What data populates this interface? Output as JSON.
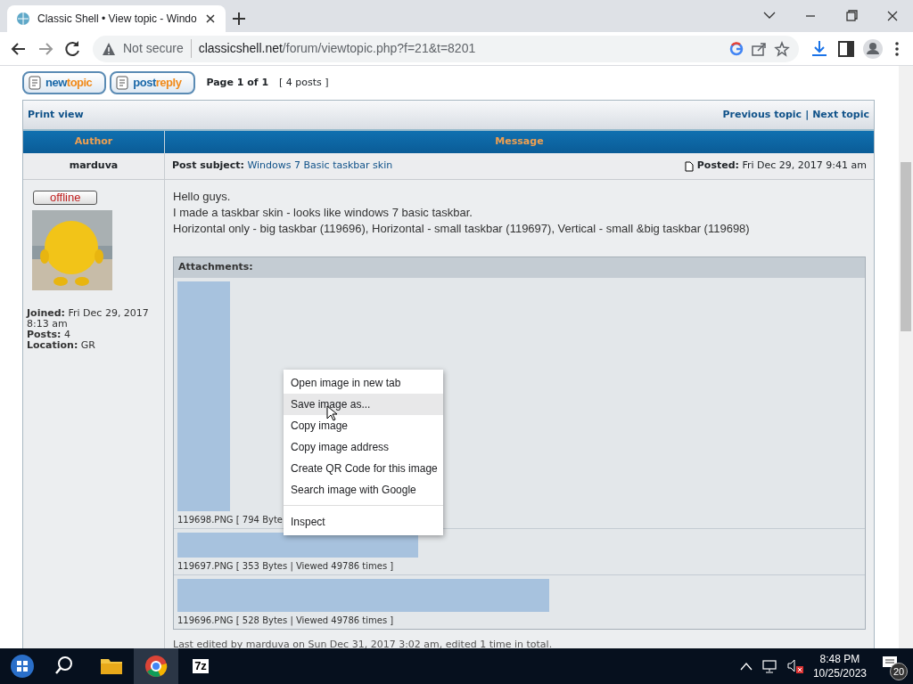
{
  "browser": {
    "tab_title": "Classic Shell • View topic - Windo",
    "security": "Not secure",
    "url_host": "classicshell.net",
    "url_path": "/forum/viewtopic.php?f=21&t=8201"
  },
  "toolbar": {
    "buttons": [
      {
        "first": "new",
        "second": "topic"
      },
      {
        "first": "post",
        "second": "reply"
      }
    ],
    "page_info": "Page 1 of 1",
    "posts_count": "[ 4 posts ]"
  },
  "nav": {
    "print_view": "Print view",
    "previous_topic": "Previous topic",
    "separator": "|",
    "next_topic": "Next topic"
  },
  "columns": [
    "Author",
    "Message"
  ],
  "post": {
    "author": "marduva",
    "status": "offline",
    "subject_label": "Post subject:",
    "subject": "Windows 7 Basic taskbar skin",
    "posted_label": "Posted:",
    "posted": "Fri Dec 29, 2017 9:41 am",
    "profile": [
      {
        "label": "Joined:",
        "value": "Fri Dec 29, 2017 8:13 am"
      },
      {
        "label": "Posts:",
        "value": "4"
      },
      {
        "label": "Location:",
        "value": "GR"
      }
    ],
    "body": [
      "Hello guys.",
      "I made a taskbar skin - looks like windows 7 basic taskbar.",
      "Horizontal only - big taskbar (119696), Horizontal - small taskbar (119697), Vertical - small &big taskbar (119698)"
    ],
    "attachments_title": "Attachments:",
    "attachments": [
      {
        "kind": "vertical",
        "info": "119698.PNG [ 794 Byte"
      },
      {
        "kind": "small",
        "info": "119697.PNG [ 353 Bytes | Viewed 49786 times ]"
      },
      {
        "kind": "big",
        "info": "119696.PNG [ 528 Bytes | Viewed 49786 times ]"
      }
    ],
    "edited": "Last edited by marduva on Sun Dec 31, 2017 3:02 am, edited 1 time in total."
  },
  "context_menu": [
    {
      "label": "Open image in new tab",
      "selected": false,
      "divider_before": false
    },
    {
      "label": "Save image as...",
      "selected": true,
      "divider_before": false
    },
    {
      "label": "Copy image",
      "selected": false,
      "divider_before": false
    },
    {
      "label": "Copy image address",
      "selected": false,
      "divider_before": false
    },
    {
      "label": "Create QR Code for this image",
      "selected": false,
      "divider_before": false
    },
    {
      "label": "Search image with Google",
      "selected": false,
      "divider_before": false
    },
    {
      "label": "Inspect",
      "selected": false,
      "divider_before": true
    }
  ],
  "taskbar": {
    "apps": [
      {
        "kind": "start",
        "selected": false
      },
      {
        "kind": "search",
        "selected": false
      },
      {
        "kind": "explorer",
        "selected": false
      },
      {
        "kind": "chrome",
        "selected": true
      },
      {
        "kind": "sevenzip",
        "label": "7z",
        "selected": false
      }
    ],
    "time": "8:48 PM",
    "date": "10/25/2023",
    "notifications": "20"
  }
}
